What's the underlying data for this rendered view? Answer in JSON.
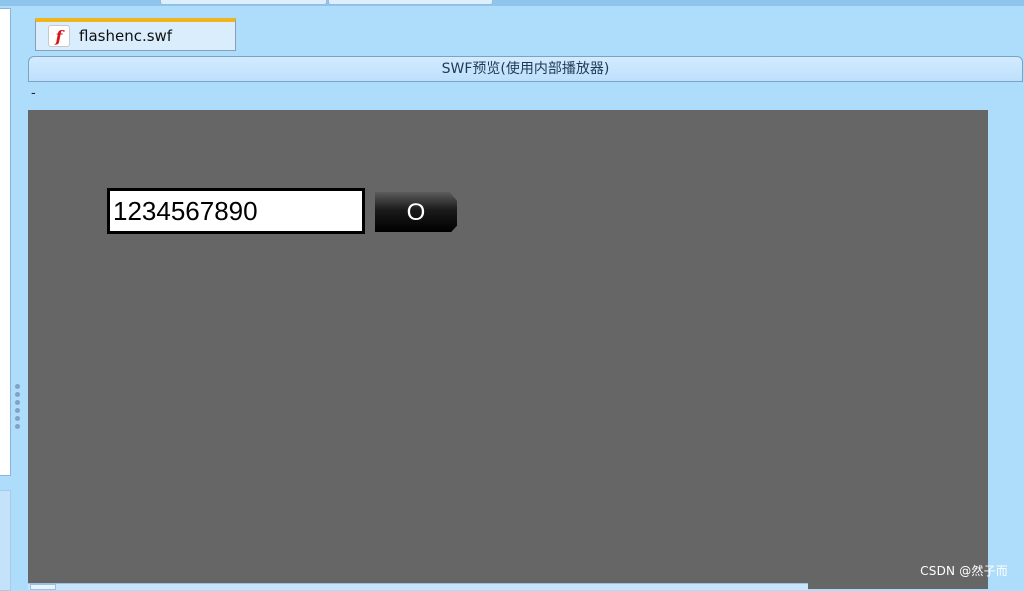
{
  "file_tab": {
    "label": "flashenc.swf",
    "icon": "flash-file-icon"
  },
  "preview": {
    "title": "SWF预览(使用内部播放器)",
    "separator": "-"
  },
  "swf": {
    "input_value": "1234567890",
    "button_label": "O"
  },
  "watermark": "CSDN @然子而",
  "colors": {
    "background": "#aedcfb",
    "stage": "#666666",
    "tab_accent": "#f0b51a",
    "flash_red": "#d8141c"
  }
}
